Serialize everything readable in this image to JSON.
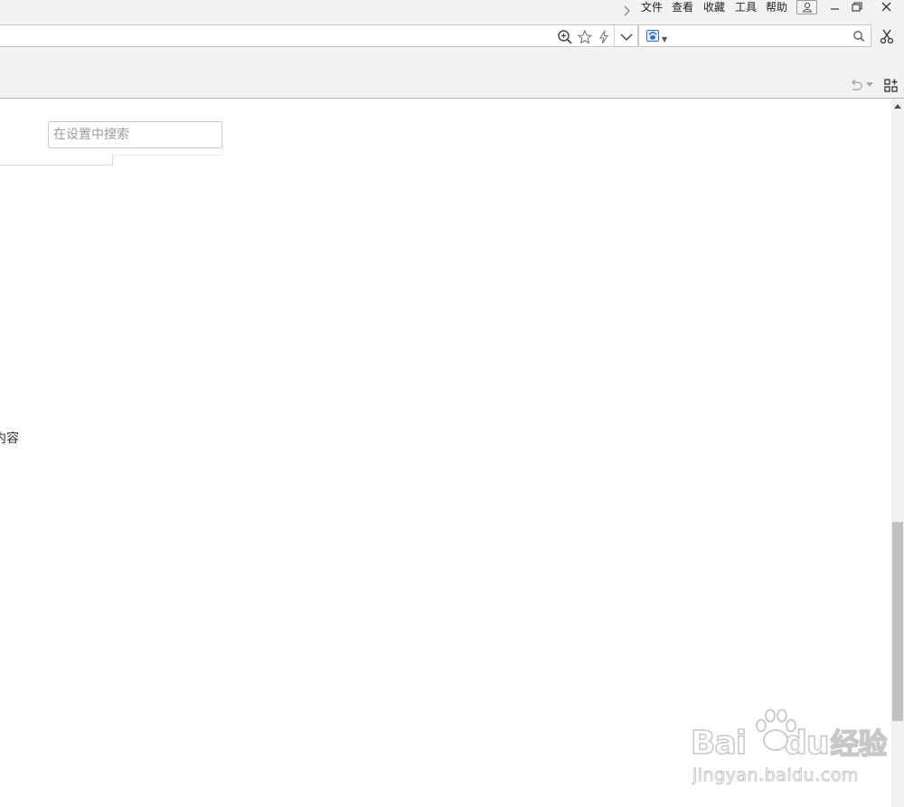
{
  "menubar": {
    "items": [
      "文件",
      "查看",
      "收藏",
      "工具",
      "帮助"
    ]
  },
  "icons": {
    "more": "chevron-right-icon",
    "user": "user-icon",
    "minimize": "minimize-icon",
    "restore": "restore-icon",
    "close": "close-icon",
    "zoom": "zoom-in-icon",
    "favorite": "star-icon",
    "speed": "lightning-icon",
    "dropdown": "chevron-down-icon",
    "engine": "baidu-paw-icon",
    "search": "search-icon",
    "cut": "scissors-icon",
    "undo": "undo-icon",
    "apps": "apps-grid-icon"
  },
  "settings": {
    "search_placeholder": "在设置中搜索",
    "clipped_text": "内容"
  },
  "watermark": {
    "brand_left": "Bai",
    "brand_right": "du",
    "brand_cn": "经验",
    "url": "jingyan.baidu.com"
  },
  "colors": {
    "chrome_bg": "#f2f2f2",
    "scroll_thumb": "#c1c1c1",
    "engine_blue": "#2f6fd6"
  }
}
